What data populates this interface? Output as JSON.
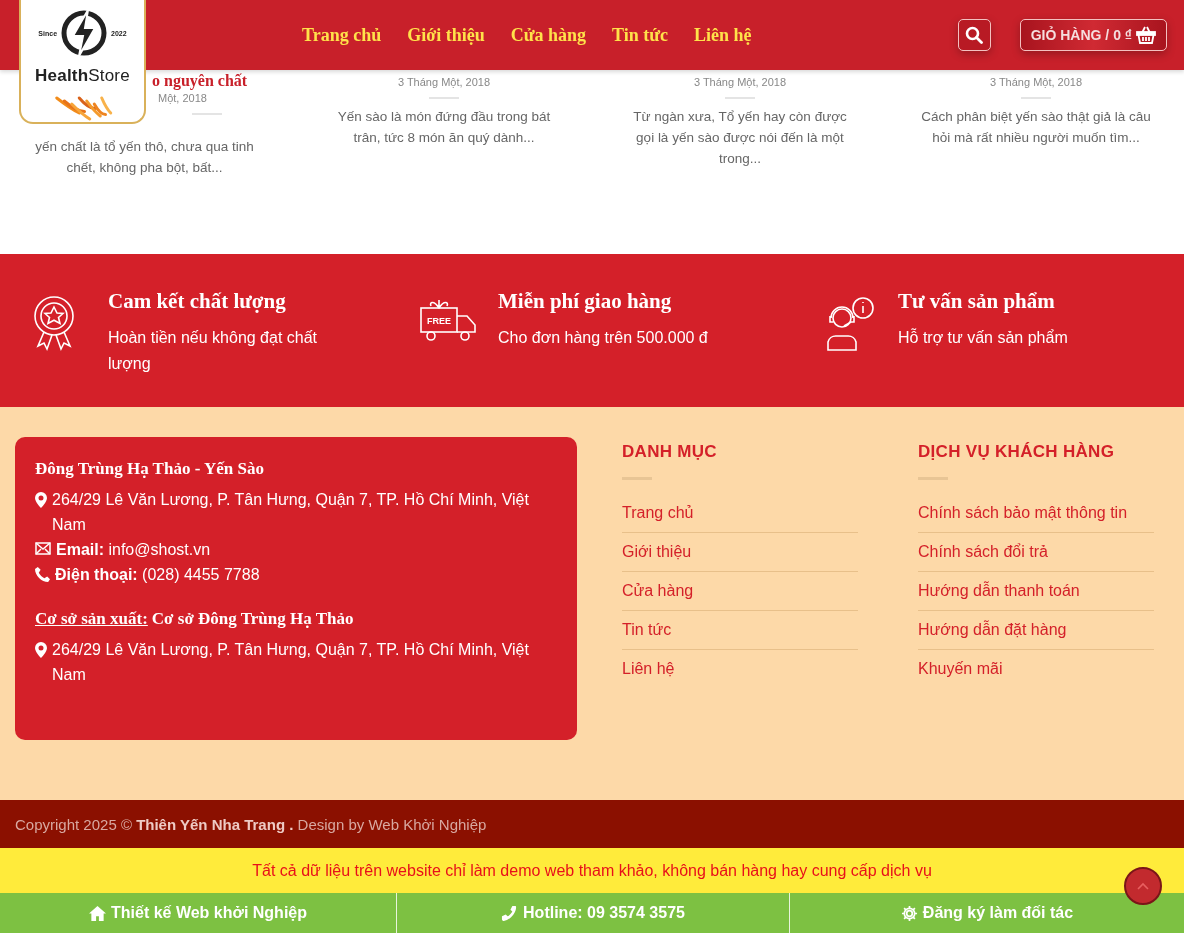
{
  "header": {
    "logo": {
      "since": "Since",
      "year": "2022",
      "brand": "**Health**Store"
    },
    "nav": [
      {
        "label": "Trang chủ"
      },
      {
        "label": "Giới thiệu"
      },
      {
        "label": "Cửa hàng"
      },
      {
        "label": "Tin tức"
      },
      {
        "label": "Liên hệ"
      }
    ],
    "cart": {
      "label": "GIỎ HÀNG / 0 ₫"
    }
  },
  "posts": [
    {
      "title": "o nguyên chất",
      "date": "Một, 2018",
      "excerpt": "yến chất  là tổ yến thô, chưa qua tinh chết, không pha bột, bất..."
    },
    {
      "date": "3 Tháng Một, 2018",
      "excerpt": "Yến sào là món đứng đầu trong bát trân, tức 8 món ăn quý dành..."
    },
    {
      "date": "3 Tháng Một, 2018",
      "excerpt": "Từ ngàn xưa, Tổ yến hay còn được gọi là yến sào được nói đến là một trong..."
    },
    {
      "date": "3 Tháng Một, 2018",
      "excerpt": "Cách phân biệt yến sào thật giả là câu hỏi mà rất nhiều người muốn tìm..."
    }
  ],
  "features": [
    {
      "kind": "award",
      "title": "Cam kết chất lượng",
      "text": "Hoàn tiền nếu không đạt chất lượng"
    },
    {
      "kind": "truck",
      "title": "Miễn phí giao hàng",
      "text": "Cho đơn hàng trên 500.000 đ",
      "badge": "FREE"
    },
    {
      "kind": "support",
      "title": "Tư vấn sản phẩm",
      "text": "Hỗ trợ tư vấn sản phẩm"
    }
  ],
  "contact": {
    "title": "Đông Trùng Hạ Thảo - Yến Sào",
    "lines": [
      {
        "kind": "address",
        "text": "264/29 Lê Văn Lương, P. Tân Hưng, Quận 7, TP. Hồ Chí Minh, Việt Nam"
      },
      {
        "kind": "email",
        "text": "**Email:** info@shost.vn"
      },
      {
        "kind": "phone",
        "text": "**Điện thoại:** (028) 4455 7788"
      }
    ],
    "factory_label": "Cơ sở sản xuất:",
    "factory_name": "Cơ sở Đông Trùng Hạ Thảo",
    "factory_lines": [
      {
        "kind": "address",
        "text": "264/29 Lê Văn Lương, P. Tân Hưng, Quận 7, TP. Hồ Chí Minh, Việt Nam"
      }
    ]
  },
  "menus": [
    {
      "heading": "DANH MỤC",
      "links": [
        "Trang chủ",
        "Giới thiệu",
        "Cửa hàng",
        "Tin tức",
        "Liên hệ"
      ]
    },
    {
      "heading": "DỊCH VỤ KHÁCH HÀNG",
      "links": [
        "Chính sách bảo mật thông tin",
        "Chính sách đổi trả",
        "Hướng dẫn thanh toán",
        "Hướng dẫn đặt hàng",
        "Khuyến mãi"
      ]
    }
  ],
  "copyright": "Copyright 2025 © **Thiên Yến Nha Trang .** Design by Web Khởi Nghiệp",
  "notice": "Tất cả dữ liệu trên website chỉ làm demo web tham khảo, không bán hàng hay cung cấp dịch vụ",
  "bottom_bar": [
    {
      "kind": "home",
      "label": "Thiết kế Web khởi Nghiệp"
    },
    {
      "kind": "phone",
      "label": "Hotline: 09 3574 3575"
    },
    {
      "kind": "gear",
      "label": "Đăng ký làm đối tác"
    }
  ]
}
